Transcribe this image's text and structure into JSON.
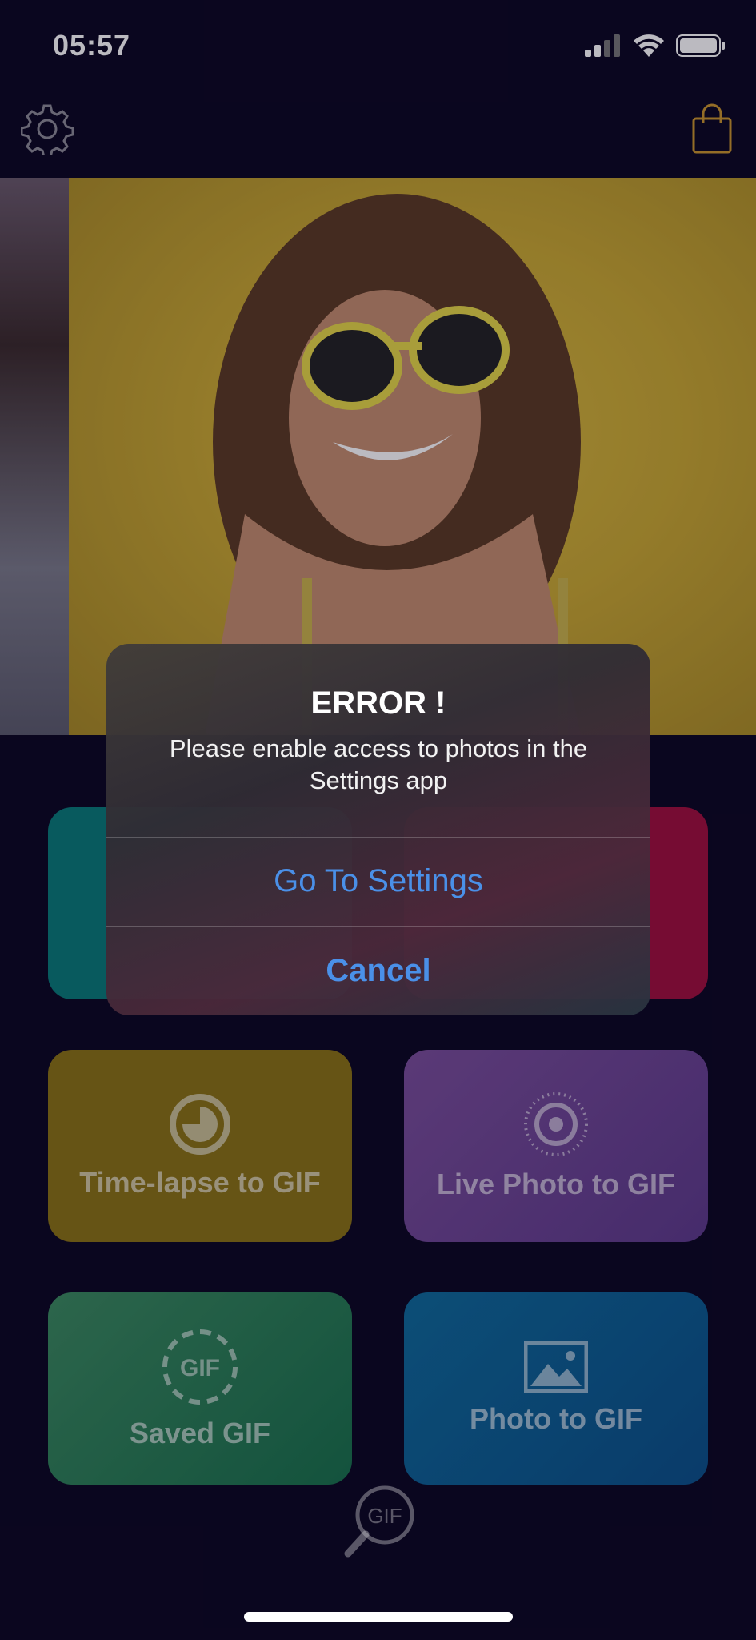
{
  "status_bar": {
    "time": "05:57"
  },
  "grid": {
    "timelapse_label": "Time-lapse to GIF",
    "live_label": "Live Photo to GIF",
    "saved_label": "Saved GIF",
    "saved_icon_text": "GIF",
    "photo_label": "Photo to GIF",
    "search_icon_text": "GIF"
  },
  "alert": {
    "title": "ERROR !",
    "message": "Please enable access to photos in the Settings app",
    "primary_action": "Go To Settings",
    "cancel_action": "Cancel"
  },
  "colors": {
    "background": "#0b0620",
    "accent_blue": "#4a90e8",
    "bag_gold": "#c9952c"
  },
  "icons": [
    "gear-icon",
    "shopping-bag-icon",
    "clock-icon",
    "live-photo-icon",
    "gif-circle-icon",
    "image-icon",
    "search-gif-icon"
  ]
}
